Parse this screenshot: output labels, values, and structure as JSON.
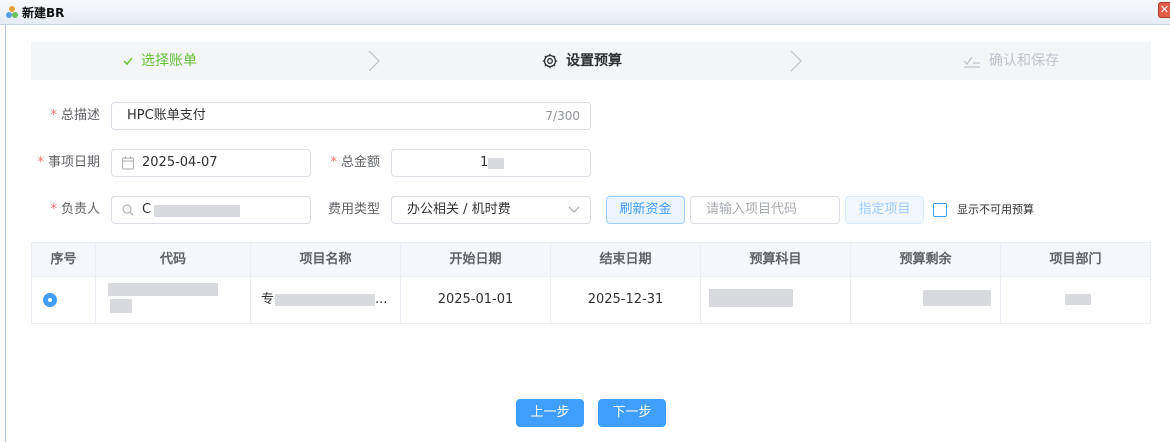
{
  "window": {
    "title": "新建BR",
    "close_label": "✕"
  },
  "steps": [
    {
      "label": "选择账单",
      "status": "done",
      "icon": "check-icon"
    },
    {
      "label": "设置预算",
      "status": "active",
      "icon": "gear-icon"
    },
    {
      "label": "确认和保存",
      "status": "pending",
      "icon": "confirm-icon"
    }
  ],
  "form": {
    "description": {
      "label": "总描述",
      "value": "HPC账单支付",
      "count": "7/300"
    },
    "date": {
      "label": "事项日期",
      "value": "2025-04-07"
    },
    "total_amount": {
      "label": "总金额",
      "value": "1"
    },
    "owner": {
      "label": "负责人",
      "value": "C"
    },
    "expense_type": {
      "label": "费用类型",
      "value": "办公相关 / 机时费"
    },
    "refresh_button": "刷新资金",
    "project_code": {
      "placeholder": "请输入项目代码"
    },
    "assign_button": "指定项目",
    "show_unavailable": {
      "label": "显示不可用预算",
      "checked": false
    }
  },
  "table": {
    "columns": [
      "序号",
      "代码",
      "项目名称",
      "开始日期",
      "结束日期",
      "预算科目",
      "预算剩余",
      "项目部门"
    ],
    "rows": [
      {
        "selected": true,
        "code": "",
        "name": "专",
        "name_suffix": "...",
        "start": "2025-01-01",
        "end": "2025-12-31",
        "subject": "",
        "remaining": "",
        "dept": ""
      }
    ]
  },
  "footer": {
    "prev_label": "上一步",
    "next_label": "下一步"
  },
  "colors": {
    "primary": "#409eff",
    "success": "#67c23a",
    "required": "#f56c6c",
    "muted": "#c0c4cc"
  }
}
